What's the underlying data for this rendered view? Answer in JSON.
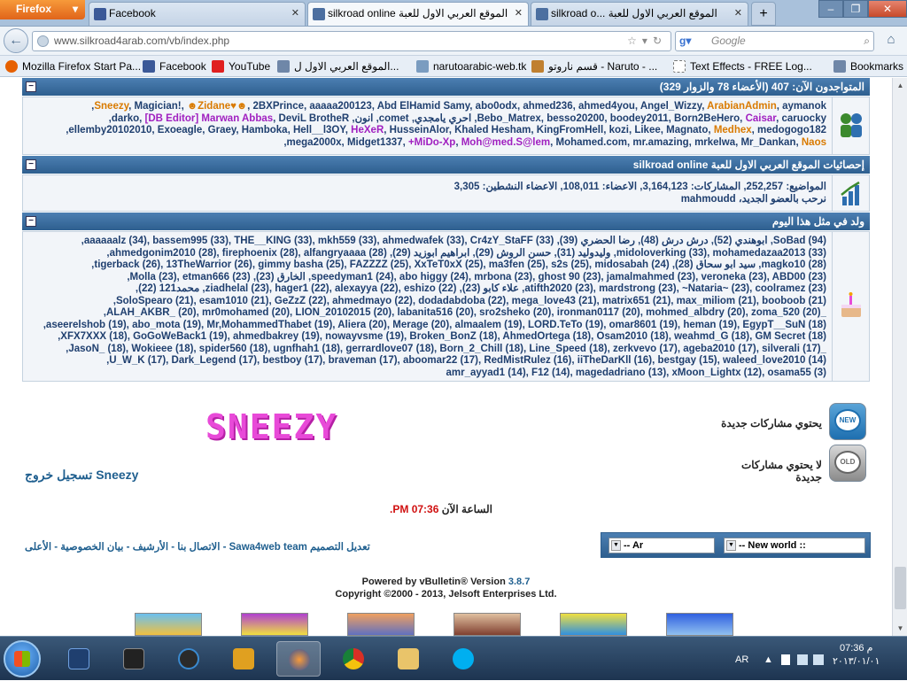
{
  "browser": {
    "app_button": "Firefox",
    "tabs": [
      {
        "label": "Facebook",
        "icon": "facebook-icon",
        "color": "#3b5998"
      },
      {
        "label": "silkroad online الموقع العربي الاول للعبة",
        "icon": "site-icon",
        "color": "#4c6fa0"
      },
      {
        "label": "silkroad o... الموقع العربي الاول للعبة",
        "icon": "site-icon",
        "color": "#4c6fa0"
      }
    ],
    "url": "www.silkroad4arab.com/vb/index.php",
    "search_placeholder": "Google",
    "bookmarks": [
      {
        "label": "Mozilla Firefox Start Pa...",
        "icon": "firefox-icon"
      },
      {
        "label": "Facebook",
        "icon": "facebook-icon"
      },
      {
        "label": "YouTube",
        "icon": "youtube-icon"
      },
      {
        "label": "الموقع العربي الاول ل...",
        "icon": "site-icon"
      },
      {
        "label": "narutoarabic-web.tk",
        "icon": "naruto-icon"
      },
      {
        "label": "قسم ناروتو - Naruto - ...",
        "icon": "naruto-icon"
      },
      {
        "label": "Text Effects - FREE Log...",
        "icon": "page-icon"
      }
    ],
    "bookmarks_menu": "Bookmarks"
  },
  "online": {
    "header": "المتواجدون الآن: 407 (الأعضاء 78 والزوار 329)",
    "members_html_lines": [
      "<span class='orange'>Sneezy</span>, Magician!, <span class='orange'>☻Zidane♥☻</span>, 2BXPrince, aaaaa200123, Abd ElHamid Samy, abo0odx, ahmed236, ahmed4you, Angel_Wizzy, <span class='orange'>ArabianAdmin</span>, aymanok,",
      "Bebo_Matrex, besso20200, boodey2011, Born2BeHero, <span class='purple'>Caisar</span>, caruocky, احري يامجدي, comet, انون, darko, <span class='purple'>[DB Editor] Marwan Abbas</span>, DeviL BrotheR,",
      "ellemby20102010, Exoeagle, Graey, Hamboka, Hell__l3OY, <span class='purple'>HeXeR</span>, HusseinAlor, Khaled Hesham, KingFromHell, kozi, Likee, Magnato, <span class='orange'>Medhex</span>, medogogo182,",
      "mega2000x, Midget1337, <span class='purple'>+MiDo-Xp</span>, <span class='purple'>Moh@med.S@lem</span>, Mohamed.com, mr.amazing, mrkelwa, Mr_Dankan, <span class='orange'>Naos</span>,"
    ]
  },
  "stats": {
    "header": "إحصائيات الموقع العربي الاول للعبة silkroad online",
    "line1": "المواضيع: 252,257, المشاركات: 3,164,123, الأعضاء: 108,011, الأعضاء النشطين: 3,305",
    "line2_label": "نرحب بالعضو الجديد،",
    "line2_name": "mahmoudd"
  },
  "birthdays": {
    "header": "ولد في مثل هذا اليوم",
    "lines": [
      "SoBad (94), أبوهندي (52), درش درش (48), رضا الحضري (39), aaaaaalz (34), bassem995 (33), THE__KING (33), mkh559 (33), ahmedwafek (33), Cr4zY_StaFF (33),",
      "midoloverking (33), mohamedazaa2013 (33), وليدوليد (31), حسن الروش (29), ابراهيم ابوزيد (29), ahmedgonim2010 (28), firephoenix (28), alfangryaaaa (28),",
      "magko10 (28), سيد ابو سحاق (28), tigerback (26), 13TheWarrior (26), gimmy basha (25), FAZZZZ (25), XxTeT0xX (25), ma3fen (25), s2s (25), midosabah (24),",
      "speedyman1 (24), abo higgy (24), mrbona (23), ghost 90 (23), jamalmahmed (23), veroneka (23), ABD00 (23), الخارق (23), Molla (23), etman666 (23),",
      "atifth2020 (23), mardstrong (23), ~Nataria~ (23), coolramez (23), علاء كابو (23), ziadhelal (23), hager1 (22), alexayya (22), eshizo (22), محمد121 (22),",
      "SoloSpearo (21), esam1010 (21), GeZzZ (22), ahmedmayo (22), dodadabdoba (22), mega_love43 (21), matrix651 (21), max_miliom (21), booboob (21),",
      "_ALAH_AKBR_ (20), mr0mohamed (20), LION_20102015 (20), labanita516 (20), sro2sheko (20), ironman0117 (20), mohmed_albdry (20), zoma_520 (20),",
      "aseerelshob (19), abo_mota (19), Mr,MohammedThabet (19), Aliera (20), Merage (20), almaalem (19), LORD.TeTo (19), omar8601 (19), heman (19), EgypT__SuN (18),",
      "XFX7XXX (18), GoGoWeBack1 (19), ahmedbakrey (19), nowayvsme (19), Broken_BonZ (18), AhmedOrtega (18), Osam2010 (18), weahmd_G (18), GM Secret (18),",
      "_JasoN_ (18), Wokieee (18), spider560 (18), ugnfhah1 (18), gerrardlove07 (18), Born_2_Chill (18), Line_Speed (18), zerkvevo (17), ageba2010 (17), silverali (17),",
      "U_W_K (17), Dark_Legend (17), bestboy (17), braveman (17), aboomar22 (17), RedMistRulez (16), iiTheDarKll (16), bestgay (15), waleed_love2010 (14),",
      "amr_ayyad1 (14), F12 (14), magedadriano (13), xMoon_Lightx (12), osama55 (3)"
    ]
  },
  "legend": {
    "new_posts": "يحتوي مشاركات جديدة",
    "no_new_posts": "لا يحتوي مشاركات جديدة",
    "new_badge": "NEW",
    "old_badge": "OLD"
  },
  "logo_text": "SNEEZY",
  "logout": "تسجيل خروج Sneezy",
  "time": {
    "label": "الساعة الآن",
    "value": "07:36 PM."
  },
  "footer": {
    "style_select": "-- New world ::",
    "lang_select": "-- Ar",
    "links": "تعديل التصميم Sawa4web team - الاتصال بنا - الأرشيف - بيان الخصوصية - الأعلى",
    "powered_prefix": "Powered by vBulletin® Version",
    "version": "3.8.7",
    "copyright": "Copyright ©2000 - 2013, Jelsoft Enterprises Ltd."
  },
  "taskbar": {
    "lang": "AR",
    "time": "07:36 م",
    "date": "٢٠١٣/٠١/٠١"
  }
}
